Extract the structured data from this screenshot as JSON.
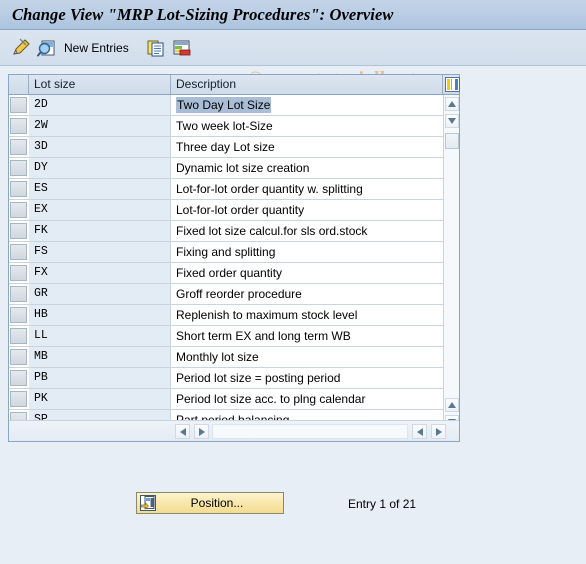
{
  "window": {
    "title": "Change View \"MRP Lot-Sizing Procedures\": Overview"
  },
  "watermark": {
    "text": "© www.tutorialkart.com",
    "color": "#e8b483"
  },
  "toolbar": {
    "items": [
      {
        "name": "display-change-icon",
        "label": "",
        "icon": "pencil-icon"
      },
      {
        "name": "details-icon",
        "label": "",
        "icon": "magnifier-document-icon"
      },
      {
        "name": "new-entries-button",
        "label": "New Entries",
        "icon": ""
      },
      {
        "name": "copy-icon",
        "label": "",
        "icon": "copy-pages-icon"
      },
      {
        "name": "delete-icon",
        "label": "",
        "icon": "table-delete-icon"
      }
    ],
    "new_entries_label": "New Entries"
  },
  "table": {
    "columns": [
      {
        "key": "select",
        "label": ""
      },
      {
        "key": "code",
        "label": "Lot size"
      },
      {
        "key": "description",
        "label": "Description"
      }
    ],
    "column_config_icon": "column-settings-icon",
    "selected_row_index": 0,
    "rows": [
      {
        "code": "2D",
        "description": "Two Day Lot Size"
      },
      {
        "code": "2W",
        "description": "Two week lot-Size"
      },
      {
        "code": "3D",
        "description": "Three day Lot size"
      },
      {
        "code": "DY",
        "description": "Dynamic lot size creation"
      },
      {
        "code": "ES",
        "description": "Lot-for-lot order quantity w. splitting"
      },
      {
        "code": "EX",
        "description": "Lot-for-lot order quantity"
      },
      {
        "code": "FK",
        "description": "Fixed lot size calcul.for sls ord.stock"
      },
      {
        "code": "FS",
        "description": "Fixing and splitting"
      },
      {
        "code": "FX",
        "description": "Fixed order quantity"
      },
      {
        "code": "GR",
        "description": "Groff reorder procedure"
      },
      {
        "code": "HB",
        "description": "Replenish to maximum stock level"
      },
      {
        "code": "LL",
        "description": "Short term EX and long term WB"
      },
      {
        "code": "MB",
        "description": "Monthly lot size"
      },
      {
        "code": "PB",
        "description": "Period lot size = posting period"
      },
      {
        "code": "PK",
        "description": "Period lot size acc. to plng calendar"
      },
      {
        "code": "SP",
        "description": "Part period balancing"
      }
    ]
  },
  "footer": {
    "position_button_label": "Position...",
    "position_button_icon": "position-icon",
    "entry_status": "Entry 1 of 21"
  },
  "colors": {
    "titlebar": "#b9cde4",
    "background": "#e8eef5",
    "row_alt": "#e3ebf4",
    "selection": "#a9bed6",
    "button_yellow": "#f8e6a8"
  }
}
